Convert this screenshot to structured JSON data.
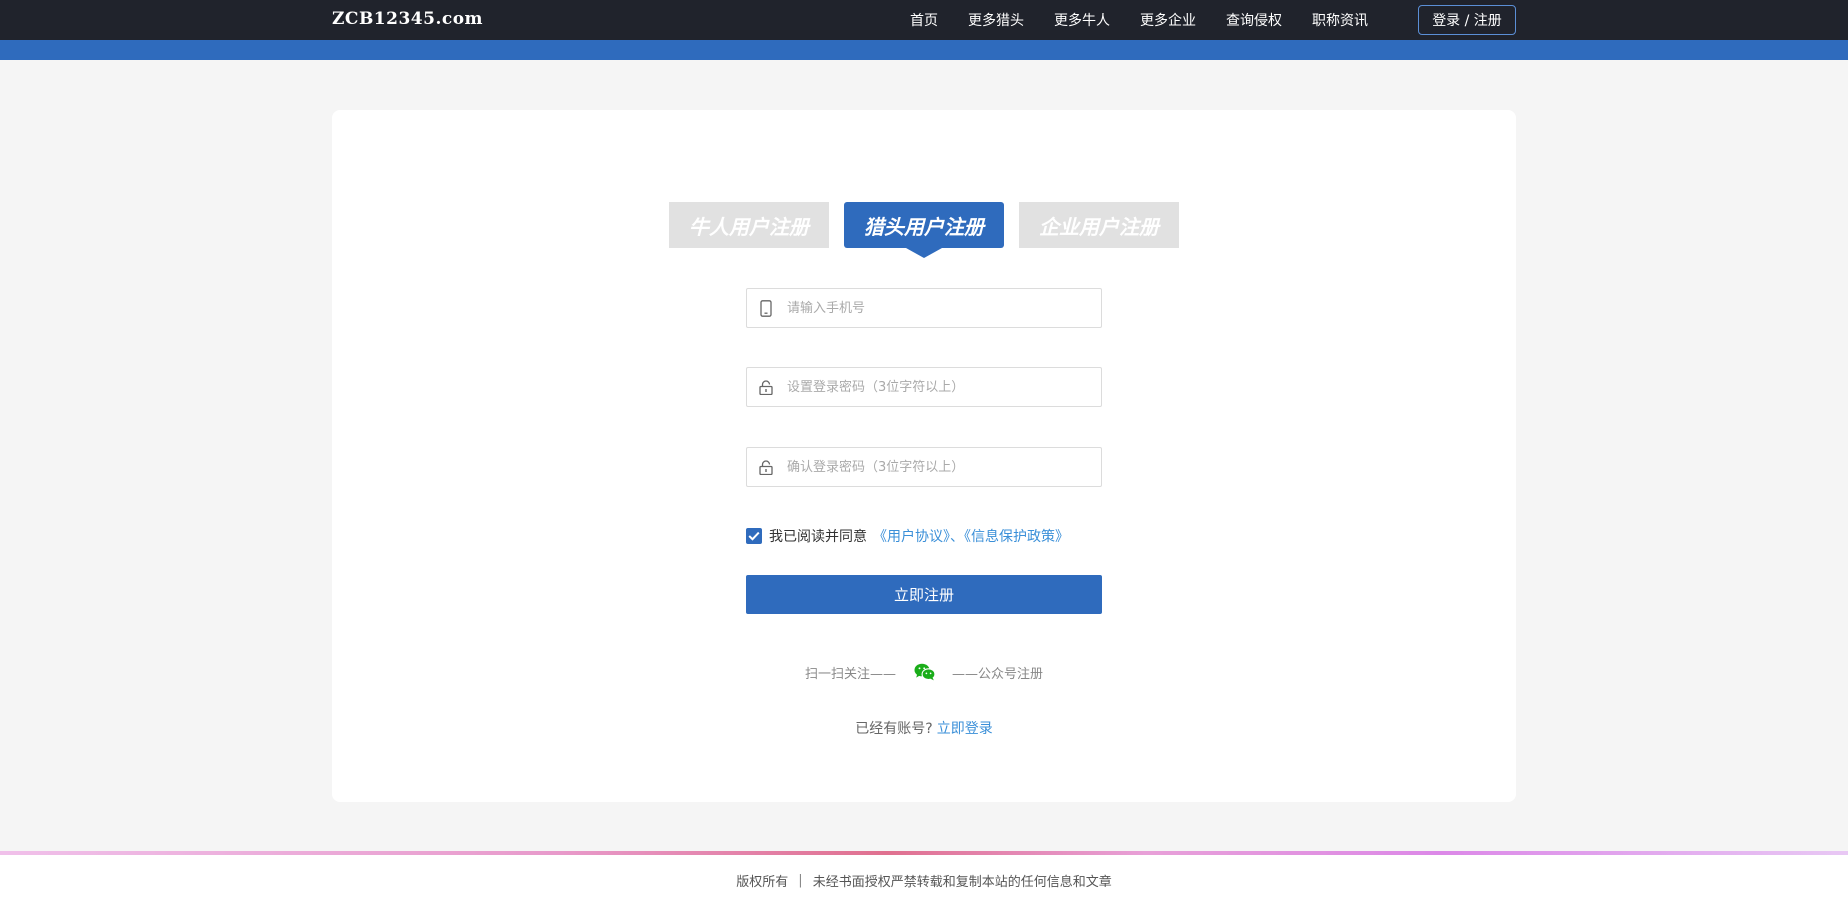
{
  "header": {
    "logo": "ZCB12345.com",
    "nav": [
      "首页",
      "更多猎头",
      "更多牛人",
      "更多企业",
      "查询侵权",
      "职称资讯"
    ],
    "login_label": "登录 / 注册"
  },
  "tabs": [
    {
      "label": "牛人用户注册",
      "active": false
    },
    {
      "label": "猎头用户注册",
      "active": true
    },
    {
      "label": "企业用户注册",
      "active": false
    }
  ],
  "form": {
    "phone_placeholder": "请输入手机号",
    "password_placeholder": "设置登录密码（3位字符以上）",
    "confirm_placeholder": "确认登录密码（3位字符以上）",
    "agree_text": "我已阅读并同意",
    "agree_link": "《用户协议》、《信息保护政策》",
    "agree_checked": true,
    "submit_label": "立即注册"
  },
  "scan": {
    "left": "扫一扫关注——",
    "right": "——公众号注册"
  },
  "login_prompt": {
    "text": "已经有账号?",
    "link": "立即登录"
  },
  "footer": {
    "left": "版权所有",
    "separator": "|",
    "right": "未经书面授权严禁转载和复制本站的任何信息和文章"
  },
  "colors": {
    "brand": "#2f6bbd",
    "link": "#3a8fd8",
    "header_bg": "#20232c",
    "wechat": "#1aad19"
  }
}
